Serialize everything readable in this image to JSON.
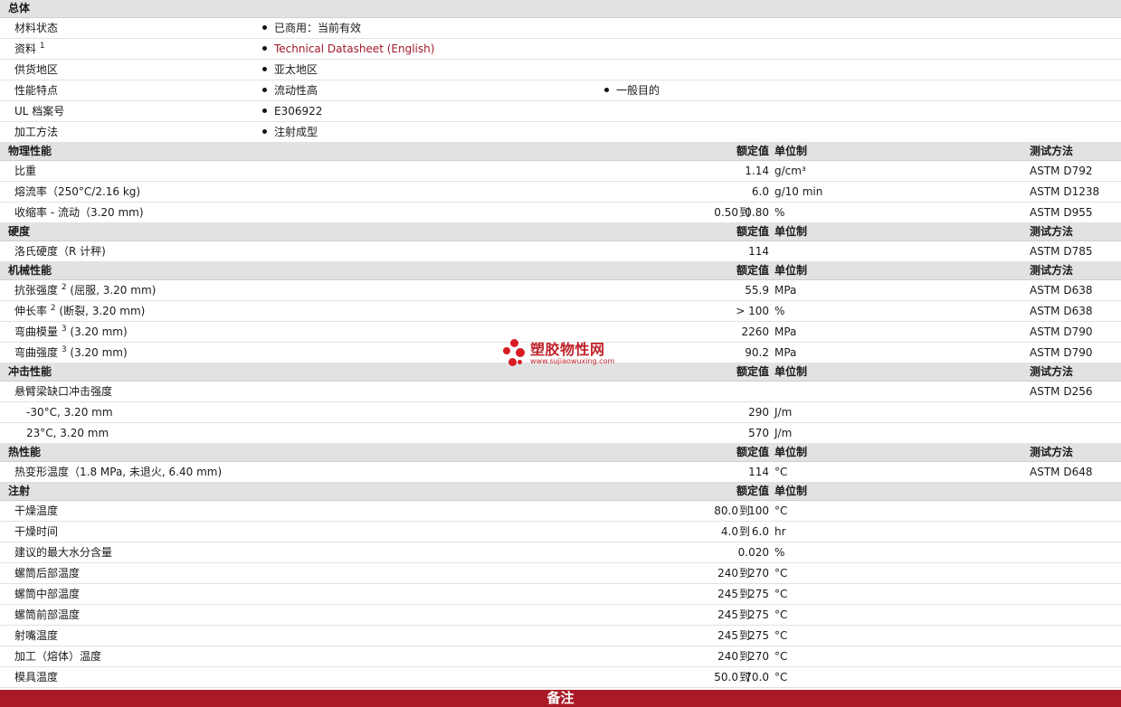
{
  "sections": {
    "general": {
      "title": "总体"
    },
    "physical": {
      "title": "物理性能",
      "col_val": "额定值",
      "col_unit": "单位制",
      "col_method": "测试方法"
    },
    "hardness": {
      "title": "硬度",
      "col_val": "额定值",
      "col_unit": "单位制",
      "col_method": "测试方法"
    },
    "mechanical": {
      "title": "机械性能",
      "col_val": "额定值",
      "col_unit": "单位制",
      "col_method": "测试方法"
    },
    "impact": {
      "title": "冲击性能",
      "col_val": "额定值",
      "col_unit": "单位制",
      "col_method": "测试方法"
    },
    "thermal": {
      "title": "热性能",
      "col_val": "额定值",
      "col_unit": "单位制",
      "col_method": "测试方法"
    },
    "injection": {
      "title": "注射",
      "col_val": "额定值",
      "col_unit": "单位制"
    }
  },
  "general_rows": [
    {
      "label": "材料状态",
      "value": "已商用：当前有效"
    },
    {
      "label": "资料",
      "sup": "1",
      "value": "Technical Datasheet (English)"
    },
    {
      "label": "供货地区",
      "value": "亚太地区"
    },
    {
      "label": "性能特点",
      "value": "流动性高",
      "value2": "一般目的"
    },
    {
      "label": "UL 档案号",
      "value": "E306922"
    },
    {
      "label": "加工方法",
      "value": "注射成型"
    }
  ],
  "physical_rows": [
    {
      "label": "比重",
      "hi": "1.14",
      "unit": "g/cm³",
      "method": "ASTM D792"
    },
    {
      "label": "熔流率（250°C/2.16 kg)",
      "hi": "6.0",
      "unit": "g/10 min",
      "method": "ASTM D1238"
    },
    {
      "label": "收缩率 - 流动（3.20 mm)",
      "lo": "0.50",
      "to": "到",
      "hi": "0.80",
      "unit": "%",
      "method": "ASTM D955"
    }
  ],
  "hardness_rows": [
    {
      "label": "洛氏硬度（R 计秤)",
      "hi": "114",
      "method": "ASTM D785"
    }
  ],
  "mechanical_rows": [
    {
      "label": "抗张强度",
      "sup": "2",
      "suffix": "(屈服, 3.20 mm)",
      "hi": "55.9",
      "unit": "MPa",
      "method": "ASTM D638"
    },
    {
      "label": "伸长率",
      "sup": "2",
      "suffix": "(断裂, 3.20 mm)",
      "hi": "> 100",
      "unit": "%",
      "method": "ASTM D638"
    },
    {
      "label": "弯曲模量",
      "sup": "3",
      "suffix": "(3.20 mm)",
      "hi": "2260",
      "unit": "MPa",
      "method": "ASTM D790"
    },
    {
      "label": "弯曲强度",
      "sup": "3",
      "suffix": "(3.20 mm)",
      "hi": "90.2",
      "unit": "MPa",
      "method": "ASTM D790"
    }
  ],
  "impact_rows": [
    {
      "label": "悬臂梁缺口冲击强度",
      "method": "ASTM D256"
    },
    {
      "label": "-30°C, 3.20 mm",
      "hi": "290",
      "unit": "J/m"
    },
    {
      "label": "23°C, 3.20 mm",
      "hi": "570",
      "unit": "J/m"
    }
  ],
  "thermal_rows": [
    {
      "label": "热变形温度（1.8 MPa, 未退火, 6.40 mm)",
      "hi": "114",
      "unit": "°C",
      "method": "ASTM D648"
    }
  ],
  "injection_rows": [
    {
      "label": "干燥温度",
      "lo": "80.0",
      "to": "到",
      "hi": "100",
      "unit": "°C"
    },
    {
      "label": "干燥时间",
      "lo": "4.0",
      "to": "到",
      "hi": "6.0",
      "unit": "hr"
    },
    {
      "label": "建议的最大水分含量",
      "hi": "0.020",
      "unit": "%"
    },
    {
      "label": "螺筒后部温度",
      "lo": "240",
      "to": "到",
      "hi": "270",
      "unit": "°C"
    },
    {
      "label": "螺筒中部温度",
      "lo": "245",
      "to": "到",
      "hi": "275",
      "unit": "°C"
    },
    {
      "label": "螺筒前部温度",
      "lo": "245",
      "to": "到",
      "hi": "275",
      "unit": "°C"
    },
    {
      "label": "射嘴温度",
      "lo": "245",
      "to": "到",
      "hi": "275",
      "unit": "°C"
    },
    {
      "label": "加工（熔体）温度",
      "lo": "240",
      "to": "到",
      "hi": "270",
      "unit": "°C"
    },
    {
      "label": "模具温度",
      "lo": "50.0",
      "to": "到",
      "hi": "70.0",
      "unit": "°C"
    }
  ],
  "footer": {
    "title": "备注"
  },
  "watermark": {
    "text": "塑胶物性网",
    "url": "www.sujiaowuxing.com",
    "color": "#d91c24"
  }
}
